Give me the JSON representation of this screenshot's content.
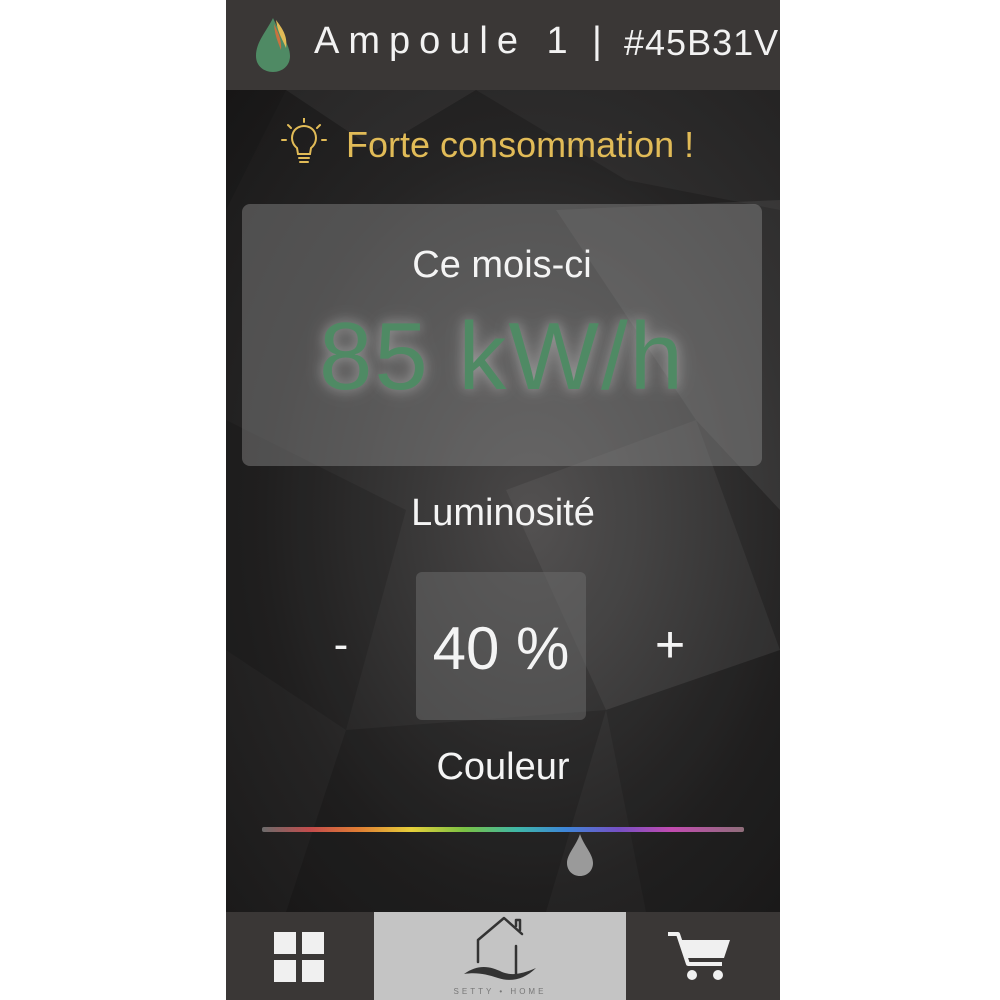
{
  "header": {
    "title": "Ampoule 1",
    "separator": "|",
    "device_id": "#45B31V",
    "logo_icon": "leaf-flame-logo"
  },
  "alert": {
    "icon": "lightbulb-icon",
    "text": "Forte consommation !",
    "color": "#e1bb57"
  },
  "consumption": {
    "label": "Ce mois-ci",
    "value": "85 kW/h",
    "value_color": "#4f8a64"
  },
  "brightness": {
    "label": "Luminosité",
    "decrease_label": "-",
    "value": "40 %",
    "increase_label": "+"
  },
  "color": {
    "label": "Couleur",
    "hue_position": 0.66,
    "thumb_icon": "droplet-icon"
  },
  "nav": {
    "items": [
      {
        "name": "dashboard",
        "icon": "grid-icon"
      },
      {
        "name": "home",
        "icon": "house-icon",
        "caption": "SETTY • HOME",
        "active": true
      },
      {
        "name": "shop",
        "icon": "cart-icon"
      }
    ]
  }
}
